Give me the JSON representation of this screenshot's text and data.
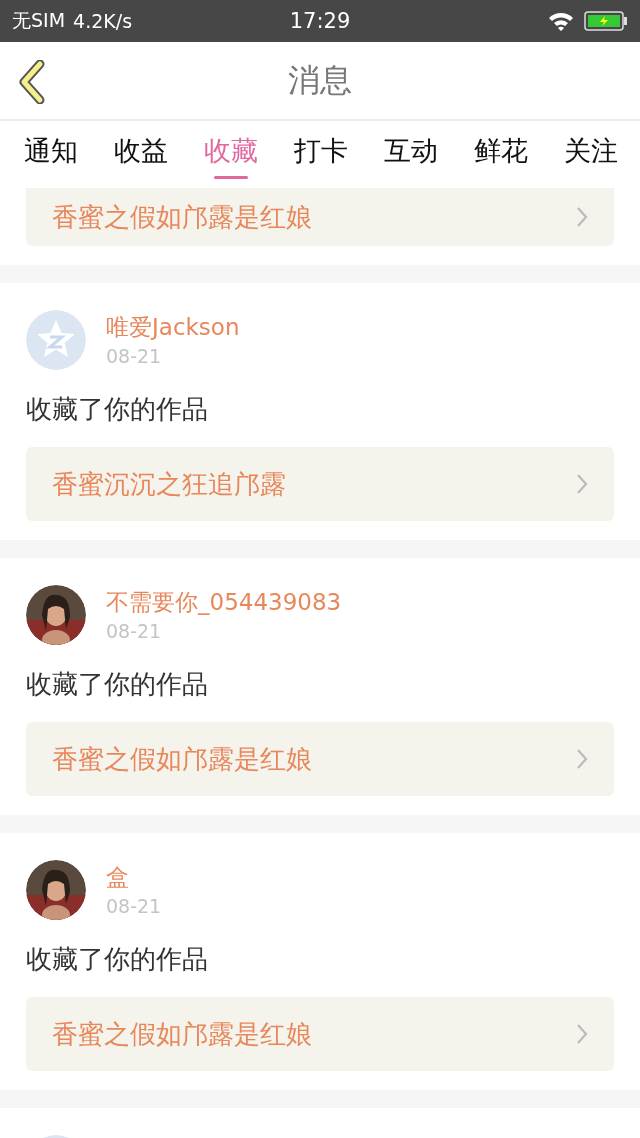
{
  "status_bar": {
    "carrier": "无SIM",
    "speed": "4.2K/s",
    "time": "17:29"
  },
  "header": {
    "title": "消息"
  },
  "tabs": [
    {
      "label": "通知",
      "selected": false
    },
    {
      "label": "收益",
      "selected": false
    },
    {
      "label": "收藏",
      "selected": true
    },
    {
      "label": "打卡",
      "selected": false
    },
    {
      "label": "互动",
      "selected": false
    },
    {
      "label": "鲜花",
      "selected": false
    },
    {
      "label": "关注",
      "selected": false
    }
  ],
  "notifications": [
    {
      "kind": "partial",
      "work": "香蜜之假如邝露是红娘"
    },
    {
      "kind": "full",
      "avatar": {
        "kind": "default"
      },
      "user": "唯爱Jackson",
      "date": "08-21",
      "action": "收藏了你的作品",
      "work": "香蜜沉沉之狂追邝露"
    },
    {
      "kind": "full",
      "user": "不需要你_054439083",
      "date": "08-21",
      "action": "收藏了你的作品",
      "work": "香蜜之假如邝露是红娘"
    },
    {
      "kind": "full",
      "user": "盒",
      "date": "08-21",
      "action": "收藏了你的作品",
      "work": "香蜜之假如邝露是红娘"
    },
    {
      "kind": "cut",
      "avatar": {
        "kind": "default"
      }
    }
  ]
}
